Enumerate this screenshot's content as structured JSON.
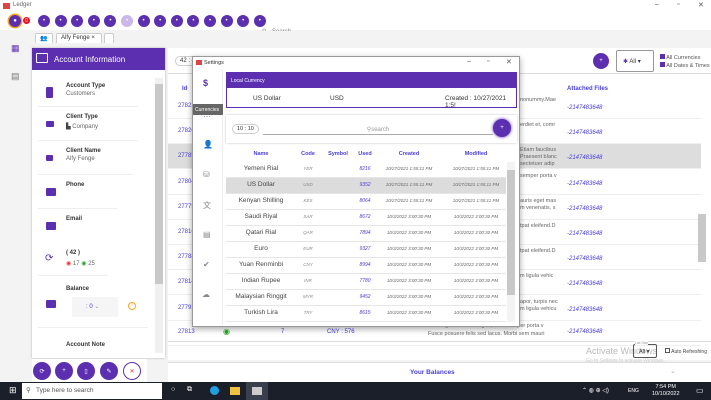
{
  "window": {
    "title": "Ledger"
  },
  "toolbar": {
    "badge": "0",
    "search_placeholder": "Search",
    "buttons": [
      "home",
      "document",
      "cloud",
      "link",
      "list",
      "disabled",
      "card",
      "settings",
      "copy",
      "cloud-upload",
      "money",
      "delete",
      "gear",
      "info"
    ]
  },
  "tabs": [
    {
      "label": "",
      "icon": "people-icon"
    },
    {
      "label": "Alfy Fenge",
      "close": "×"
    },
    {
      "label": ""
    }
  ],
  "account": {
    "header": "Account Information",
    "account_type_label": "Account Type",
    "account_type": "Customers",
    "client_type_label": "Client Type",
    "client_type": "Company",
    "client_name_label": "Client Name",
    "client_name": "Alfy Fenge",
    "phone_label": "Phone",
    "email_label": "Email",
    "count": "( 42 )",
    "red_count": "17",
    "green_count": "25",
    "balance_label": "Balance",
    "balance_value": ": 0",
    "note_label": "Account Note"
  },
  "main": {
    "counter": "42 : 4",
    "filter": "All",
    "all_currencies": "All Currencies",
    "all_dates": "All Dates & Times",
    "col_id": "Id",
    "col_attached": "Attached Files",
    "rows": [
      {
        "id": "27823",
        "desc": "nonummy.Mae",
        "files": "-2147483648"
      },
      {
        "id": "27826",
        "desc": "erdiet et, comr",
        "files": "-2147483648"
      },
      {
        "id": "27785",
        "desc": "Etiam faucibus Praesent blanc sectetuer adip",
        "files": "-2147483648",
        "selected": true
      },
      {
        "id": "27804",
        "desc": "semper porta v",
        "files": "-2147483648"
      },
      {
        "id": "27775",
        "desc": "auris eget mas m venenatis, s",
        "files": "-2147483648"
      },
      {
        "id": "27816",
        "desc": "tpat eleifend.D",
        "files": "-2147483648"
      },
      {
        "id": "27788",
        "desc": "tpat eleifend.D",
        "files": "-2147483648"
      },
      {
        "id": "27814",
        "desc": "m ligula vehic",
        "files": "-2147483648"
      },
      {
        "id": "27793",
        "desc": "apor, turpis nec m ligula vehicu",
        "files": "-2147483648"
      }
    ],
    "last_row": {
      "id": "27813",
      "num": "7",
      "currency": "CNY : 576",
      "date": "8/24/2003 3:14:16 AM",
      "desc": "Sed sagittis. Nam congue, risus semper porta v Fusce posuere felis sed lacus. Morbi sem mauri",
      "files": "-2147483648"
    },
    "list_size_label": "List Size",
    "list_size": "All",
    "auto_refresh": "Auto Refreshing",
    "watermark": "Activate Windows",
    "watermark_sub": "Go to Settings to activate Windows.",
    "balances": "Your Balances"
  },
  "settings": {
    "title": "Settings",
    "tooltip": "Currencies",
    "local_header": "Local Currency",
    "local_name": "US Dollar",
    "local_code": "USD",
    "local_created": "Created : 10/27/2021 1:5!",
    "counter": "10 : 10",
    "search_placeholder": "search",
    "columns": [
      "Name",
      "Code",
      "Symbol",
      "Used",
      "Created",
      "Modified"
    ],
    "rows": [
      [
        "Yemeni Rial",
        "YER",
        "",
        "8216",
        "10/27/2021 1:55:11 PM",
        "10/27/2021 1:55:11 PM"
      ],
      [
        "US Dollar",
        "USD",
        "",
        "9352",
        "10/27/2021 1:55:11 PM",
        "10/27/2021 1:55:11 PM"
      ],
      [
        "Kenyan Shilling",
        "KES",
        "",
        "8064",
        "10/27/2021 1:55:11 PM",
        "10/27/2021 1:55:11 PM"
      ],
      [
        "Saudi Riyal",
        "SAR",
        "",
        "8672",
        "10/3/2022 3:00:30 PM",
        "10/3/2022 3:00:30 PM"
      ],
      [
        "Qatari Rial",
        "QAR",
        "",
        "7894",
        "10/3/2022 3:00:30 PM",
        "10/3/2022 3:00:30 PM"
      ],
      [
        "Euro",
        "EUR",
        "",
        "9327",
        "10/3/2022 3:00:30 PM",
        "10/3/2022 3:00:30 PM"
      ],
      [
        "Yuan Renminbi",
        "CNY",
        "",
        "8994",
        "10/3/2022 3:00:30 PM",
        "10/3/2022 3:00:30 PM"
      ],
      [
        "Indian Rupee",
        "INR",
        "",
        "7780",
        "10/3/2022 3:00:30 PM",
        "10/3/2022 3:00:30 PM"
      ],
      [
        "Malaysian Ringgit",
        "MYR",
        "",
        "9452",
        "10/3/2022 3:00:30 PM",
        "10/3/2022 3:00:30 PM"
      ],
      [
        "Turkish Lira",
        "TRY",
        "",
        "8615",
        "10/3/2022 3:00:30 PM",
        "10/3/2022 3:00:30 PM"
      ]
    ],
    "selected_row": 1
  },
  "taskbar": {
    "search_placeholder": "Type here to search",
    "time": "7:54 PM",
    "date": "10/10/2022",
    "lang": "ENG"
  },
  "colors": {
    "accent": "#5b2fb0",
    "link": "#4a3fd8",
    "badge": "#e81123",
    "warning": "#f5a623"
  }
}
